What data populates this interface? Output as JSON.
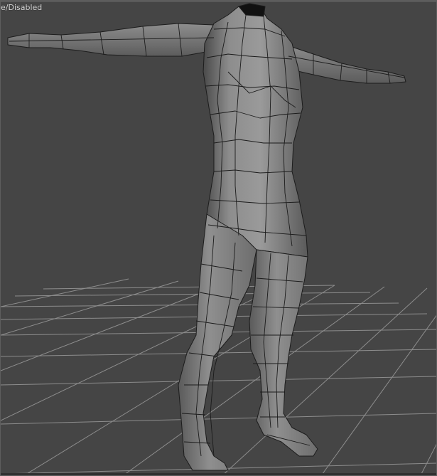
{
  "viewport": {
    "label": "e/Disabled",
    "background_color": "#454545",
    "grid_color": "#8e8e8e",
    "mesh_color": "#8a8a8a",
    "wire_color": "#1b1b1b"
  },
  "scene": {
    "object_icon": "wireframe-human-figure-icon"
  }
}
